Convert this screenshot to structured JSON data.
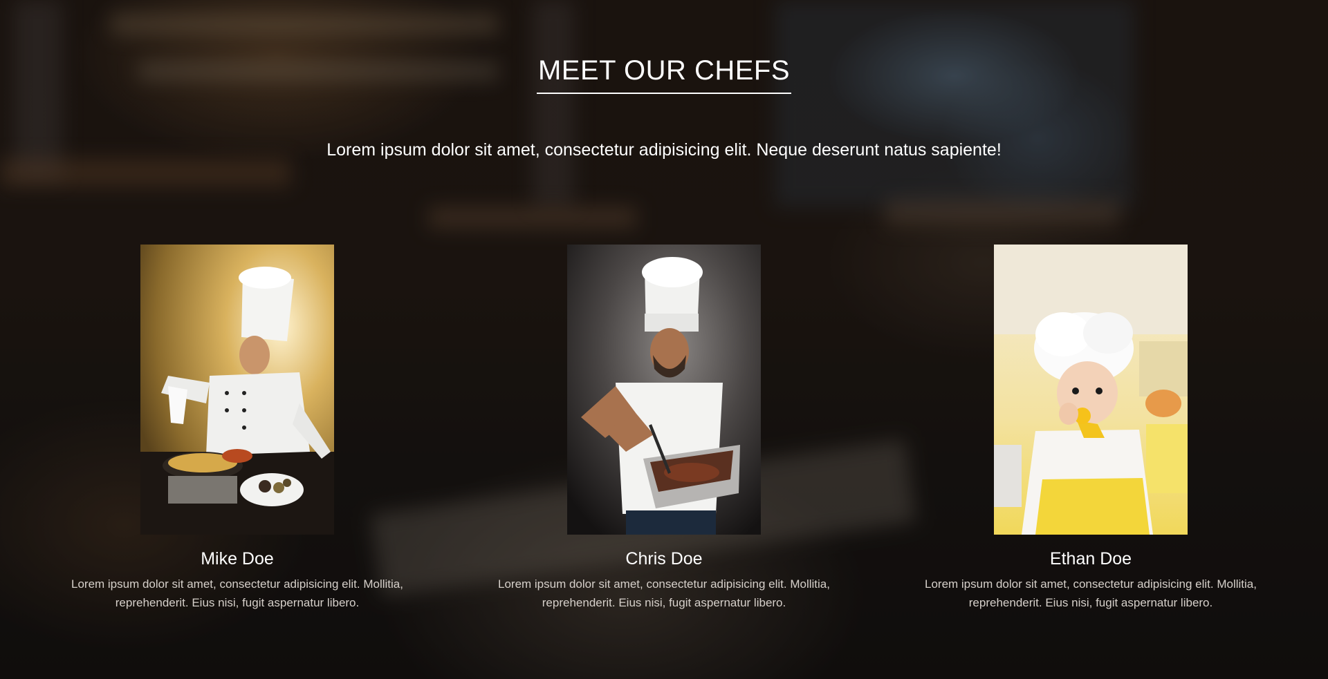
{
  "section": {
    "title": "MEET OUR CHEFS",
    "subtitle": "Lorem ipsum dolor sit amet, consectetur adipisicing elit. Neque deserunt natus sapiente!"
  },
  "chefs": [
    {
      "name": "Mike Doe",
      "description": "Lorem ipsum dolor sit amet, consectetur adipisicing elit. Mollitia, reprehenderit. Eius nisi, fugit aspernatur libero.",
      "photo": "chef-pouring-sauce-photo"
    },
    {
      "name": "Chris Doe",
      "description": "Lorem ipsum dolor sit amet, consectetur adipisicing elit. Mollitia, reprehenderit. Eius nisi, fugit aspernatur libero.",
      "photo": "chef-carving-meat-photo"
    },
    {
      "name": "Ethan Doe",
      "description": "Lorem ipsum dolor sit amet, consectetur adipisicing elit. Mollitia, reprehenderit. Eius nisi, fugit aspernatur libero.",
      "photo": "baby-chef-photo"
    }
  ],
  "colors": {
    "text": "#ffffff",
    "muted_text": "#d6d0ca"
  }
}
